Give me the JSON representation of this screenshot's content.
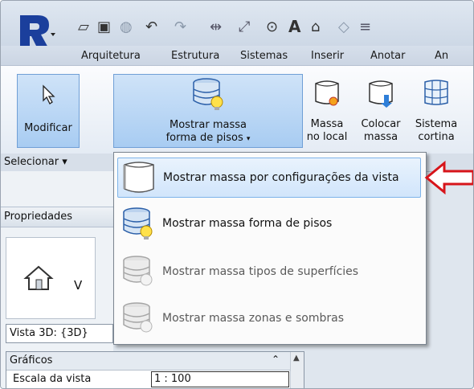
{
  "qat": {
    "icons": [
      "revit-logo-icon",
      "open-icon",
      "save-icon",
      "sync-icon",
      "undo-icon",
      "redo-icon",
      "measure-icon",
      "dimension-icon",
      "tag-icon",
      "text-icon",
      "3d-view-icon",
      "section-icon"
    ],
    "text_glyph": "A"
  },
  "tabs": [
    "Arquitetura",
    "Estrutura",
    "Sistemas",
    "Inserir",
    "Anotar",
    "An"
  ],
  "ribbon": {
    "modify_label": "Modificar",
    "show_mass_label_1": "Mostrar massa",
    "show_mass_label_2": "forma de pisos",
    "mass_inplace_1": "Massa",
    "mass_inplace_2": "no local",
    "place_mass_1": "Colocar",
    "place_mass_2": "massa",
    "curtain_1": "Sistema",
    "curtain_2": "cortina"
  },
  "panel": {
    "select_label": "Selecionar ▾"
  },
  "dropdown": {
    "items": [
      {
        "label": "Mostrar massa  por configurações da vista",
        "icon": "mass-view-settings-icon"
      },
      {
        "label": "Mostrar massa  forma de pisos",
        "icon": "mass-floor-icon"
      },
      {
        "label": "Mostrar massa  tipos de superfícies",
        "icon": "mass-surface-types-icon"
      },
      {
        "label": "Mostrar massa  zonas e sombras",
        "icon": "mass-zones-icon"
      }
    ]
  },
  "properties": {
    "title": "Propriedades",
    "type_label": "V",
    "view_selector": "Vista 3D: {3D}",
    "section": "Gráficos",
    "row_label": "Escala da vista",
    "row_value": "1 : 100"
  },
  "colors": {
    "accent": "#d7141a",
    "highlight": "#cfe3f8"
  }
}
